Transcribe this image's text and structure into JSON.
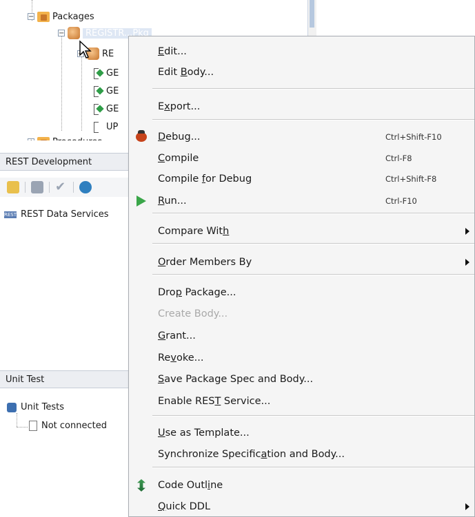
{
  "tree": {
    "packages_label": "Packages",
    "selected_package_label": "REGISTR...Pkg",
    "child_package_label": "RE",
    "procedures": [
      "GE",
      "GE",
      "GE",
      "UP"
    ],
    "procedures_folder_label": "Procedures"
  },
  "rest_panel": {
    "title": "REST Development",
    "icon_badge": "REST",
    "item_label": "REST Data Services"
  },
  "unit_panel": {
    "title": "Unit Test",
    "root_label": "Unit Tests",
    "child_label": "Not connected"
  },
  "menu": {
    "items": [
      {
        "label_pre": "",
        "mnemonic": "E",
        "label_post": "dit...",
        "shortcut": "",
        "submenu": false,
        "enabled": true
      },
      {
        "label_pre": "Edit ",
        "mnemonic": "B",
        "label_post": "ody...",
        "shortcut": "",
        "submenu": false,
        "enabled": true
      },
      {
        "label_pre": "E",
        "mnemonic": "x",
        "label_post": "port...",
        "shortcut": "",
        "submenu": false,
        "enabled": true
      },
      {
        "label_pre": "",
        "mnemonic": "D",
        "label_post": "ebug...",
        "shortcut": "Ctrl+Shift-F10",
        "submenu": false,
        "enabled": true,
        "icon": "debug-bug-icon"
      },
      {
        "label_pre": "",
        "mnemonic": "C",
        "label_post": "ompile",
        "shortcut": "Ctrl-F8",
        "submenu": false,
        "enabled": true
      },
      {
        "label_pre": "Compile ",
        "mnemonic": "f",
        "label_post": "or Debug",
        "shortcut": "Ctrl+Shift-F8",
        "submenu": false,
        "enabled": true
      },
      {
        "label_pre": "",
        "mnemonic": "R",
        "label_post": "un...",
        "shortcut": "Ctrl-F10",
        "submenu": false,
        "enabled": true,
        "icon": "run-play-icon"
      },
      {
        "label_pre": "Compare Wit",
        "mnemonic": "h",
        "label_post": "",
        "shortcut": "",
        "submenu": true,
        "enabled": true
      },
      {
        "label_pre": "",
        "mnemonic": "O",
        "label_post": "rder Members By",
        "shortcut": "",
        "submenu": true,
        "enabled": true
      },
      {
        "label_pre": "Dro",
        "mnemonic": "p",
        "label_post": " Package...",
        "shortcut": "",
        "submenu": false,
        "enabled": true
      },
      {
        "label_pre": "Create Body...",
        "mnemonic": "",
        "label_post": "",
        "shortcut": "",
        "submenu": false,
        "enabled": false
      },
      {
        "label_pre": "",
        "mnemonic": "G",
        "label_post": "rant...",
        "shortcut": "",
        "submenu": false,
        "enabled": true
      },
      {
        "label_pre": "Re",
        "mnemonic": "v",
        "label_post": "oke...",
        "shortcut": "",
        "submenu": false,
        "enabled": true
      },
      {
        "label_pre": "",
        "mnemonic": "S",
        "label_post": "ave Package Spec and Body...",
        "shortcut": "",
        "submenu": false,
        "enabled": true
      },
      {
        "label_pre": "Enable RES",
        "mnemonic": "T",
        "label_post": " Service...",
        "shortcut": "",
        "submenu": false,
        "enabled": true
      },
      {
        "label_pre": "",
        "mnemonic": "U",
        "label_post": "se as Template...",
        "shortcut": "",
        "submenu": false,
        "enabled": true
      },
      {
        "label_pre": "Synchronize Specific",
        "mnemonic": "a",
        "label_post": "tion and Body...",
        "shortcut": "",
        "submenu": false,
        "enabled": true
      },
      {
        "label_pre": "Code Outl",
        "mnemonic": "i",
        "label_post": "ne",
        "shortcut": "",
        "submenu": false,
        "enabled": true,
        "icon": "code-outline-icon"
      },
      {
        "label_pre": "",
        "mnemonic": "Q",
        "label_post": "uick DDL",
        "shortcut": "",
        "submenu": true,
        "enabled": true
      }
    ]
  }
}
